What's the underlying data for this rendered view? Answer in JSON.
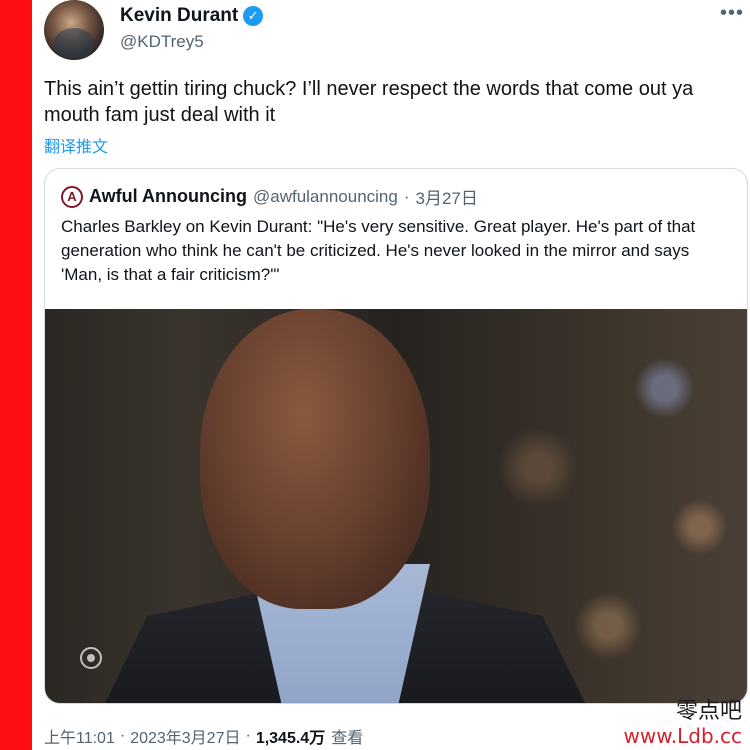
{
  "author": {
    "display_name": "Kevin Durant",
    "handle": "@KDTrey5",
    "verified_glyph": "✓"
  },
  "more_icon": "•••",
  "tweet": {
    "text": "This ain’t gettin tiring chuck? I’ll never respect the words that come out ya mouth fam just deal with it",
    "translate_label": "翻译推文"
  },
  "quote": {
    "avatar_glyph": "A",
    "name": "Awful Announcing",
    "handle": "@awfulannouncing",
    "separator": "·",
    "date": "3月27日",
    "text": "Charles Barkley on Kevin Durant: \"He's very sensitive. Great player. He's part of that generation who think he can't be criticized. He's never looked in the mirror and says 'Man, is that a fair criticism?'\""
  },
  "meta": {
    "time": "上午11:01",
    "separator1": "·",
    "date": "2023年3月27日",
    "separator2": "·",
    "views": "1,345.4万",
    "views_label": "查看"
  },
  "watermark": {
    "chinese": "零点吧",
    "url": "www.Ldb.cc"
  },
  "colors": {
    "side_bar": "#ff0f14",
    "verified": "#1d9bf0",
    "link": "#1d9bf0",
    "secondary_text": "#536471",
    "watermark_url": "#d4202a"
  }
}
